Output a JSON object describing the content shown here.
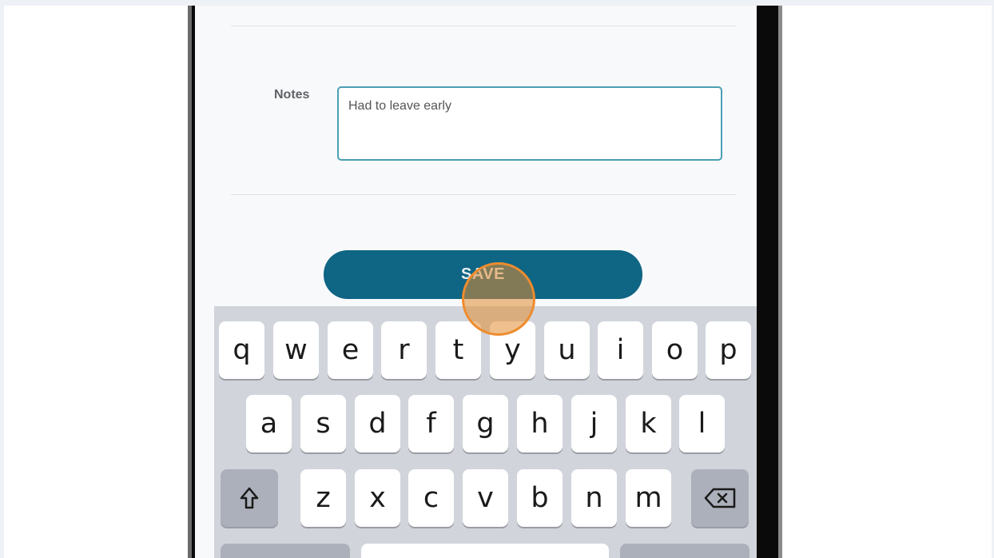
{
  "form": {
    "notes_label": "Notes",
    "notes_value": "Had to leave early",
    "save_label": "SAVE"
  },
  "keyboard": {
    "row1": [
      "q",
      "w",
      "e",
      "r",
      "t",
      "y",
      "u",
      "i",
      "o",
      "p"
    ],
    "row2": [
      "a",
      "s",
      "d",
      "f",
      "g",
      "h",
      "j",
      "k",
      "l"
    ],
    "row3": [
      "z",
      "x",
      "c",
      "v",
      "b",
      "n",
      "m"
    ],
    "shift_icon": "shift-arrow-icon",
    "delete_icon": "backspace-icon"
  },
  "colors": {
    "accent": "#0f6584",
    "input_border": "#4a9fb3",
    "touch": "#ee8c2e",
    "keyboard_bg": "#d1d4db"
  }
}
